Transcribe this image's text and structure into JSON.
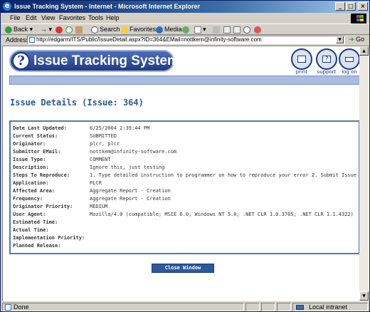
{
  "window": {
    "title": "Issue Tracking System - Internet - Microsoft Internet Explorer",
    "controls": [
      "_",
      "□",
      "×"
    ]
  },
  "menu": [
    "File",
    "Edit",
    "View",
    "Favorites",
    "Tools",
    "Help"
  ],
  "toolbar": {
    "back": "Back",
    "search": "Search",
    "favorites": "Favorites",
    "media": "Media"
  },
  "address": {
    "label": "Address",
    "url": "http://edgarm/ITS/Public/IssueDetail.aspx?ID=364&EMail=nottkem@infinity-software.com",
    "go": "Go"
  },
  "page": {
    "logo_text": "Issue Tracking System",
    "nav": [
      {
        "label": "print",
        "icon": "printer-icon"
      },
      {
        "label": "support",
        "icon": "support-icon"
      },
      {
        "label": "log on",
        "icon": "keyboard-icon"
      }
    ],
    "title": "Issue Details (Issue: 364)",
    "details": [
      {
        "key": "Date Last Updated:",
        "value": "6/25/2004 2:39:44 PM"
      },
      {
        "key": "Current Status:",
        "value": "SUBMITTED"
      },
      {
        "key": "Originator:",
        "value": "plcr, plcr"
      },
      {
        "key": "Submittor EMail:",
        "value": "nottkem@infinity-software.com"
      },
      {
        "key": "Issue Type:",
        "value": "COMMENT"
      },
      {
        "key": "Description:",
        "value": "Ignore this, just testing"
      },
      {
        "key": "Steps To Reproduce:",
        "value": "1. Type detailed instruction to programmer on how to reproduce your error 2. Submit Issue"
      },
      {
        "key": "Application:",
        "value": "PLCR"
      },
      {
        "key": "Affected Area:",
        "value": "Aggregate Report - Creation"
      },
      {
        "key": "Frequency:",
        "value": "Aggregate Report - Creation"
      },
      {
        "key": "Originator Priority:",
        "value": "MEDIUM"
      },
      {
        "key": "User Agent:",
        "value": "Mozilla/4.0 (compatible; MSIE 6.0; Windows NT 5.0; .NET CLR 1.0.3705; .NET CLR 1.1.4322)"
      },
      {
        "key": "Estimated Time:",
        "value": ""
      },
      {
        "key": "Actual Time:",
        "value": ""
      },
      {
        "key": "Implementation Priority:",
        "value": ""
      },
      {
        "key": "Planned Release:",
        "value": ""
      }
    ],
    "close_button": "Close Window"
  },
  "status": {
    "left": "Done",
    "zone": "Local intranet"
  },
  "colors": {
    "brand_blue": "#1e3a84",
    "title_blue": "#2d5b94",
    "button_blue": "#2c5a9c",
    "bar_blue": "#a7bce0"
  }
}
